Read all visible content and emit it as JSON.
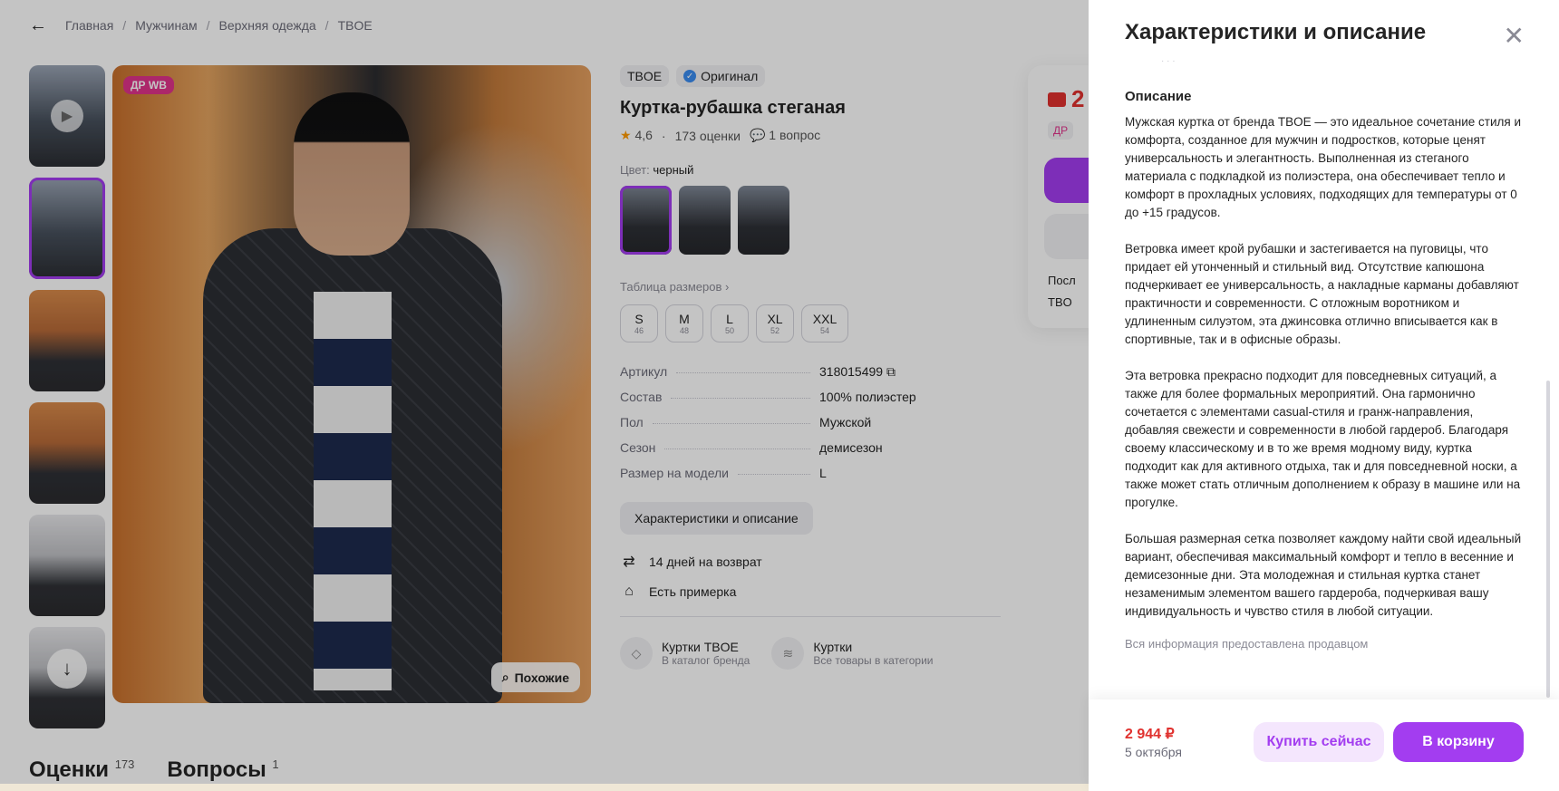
{
  "breadcrumb": {
    "back_label": "←",
    "items": [
      "Главная",
      "Мужчинам",
      "Верхняя одежда",
      "TBOE"
    ],
    "separator": "/"
  },
  "gallery": {
    "badge": "ДР WB",
    "similar_label": "Похожие"
  },
  "product": {
    "brand": "TBOE",
    "original_label": "Оригинал",
    "title": "Куртка-рубашка стеганая",
    "rating": "4,6",
    "reviews": "173 оценки",
    "questions": "1 вопрос",
    "color_label": "Цвет:",
    "color_value": "черный",
    "size_table_label": "Таблица размеров ›",
    "sizes": [
      {
        "size": "S",
        "num": "46"
      },
      {
        "size": "M",
        "num": "48"
      },
      {
        "size": "L",
        "num": "50"
      },
      {
        "size": "XL",
        "num": "52"
      },
      {
        "size": "XXL",
        "num": "54"
      }
    ],
    "params": [
      {
        "k": "Артикул",
        "v": "318015499"
      },
      {
        "k": "Состав",
        "v": "100% полиэстер"
      },
      {
        "k": "Пол",
        "v": "Мужской"
      },
      {
        "k": "Сезон",
        "v": "демисезон"
      },
      {
        "k": "Размер на модели",
        "v": "L"
      }
    ],
    "chars_button": "Характеристики и описание",
    "return_label": "14 дней на возврат",
    "fitting_label": "Есть примерка",
    "brand_cat_title": "Куртки TBOE",
    "brand_cat_sub": "В каталог бренда",
    "cat_title": "Куртки",
    "cat_sub": "Все товары в категории"
  },
  "buybox": {
    "price_partial": "2",
    "dr_partial": "ДР",
    "line1": "Посл",
    "line2": "TBO"
  },
  "bottom_tabs": {
    "reviews_label": "Оценки",
    "reviews_count": "173",
    "questions_label": "Вопросы",
    "questions_count": "1"
  },
  "panel": {
    "title": "Характеристики и описание",
    "close_icon": "✕",
    "section_title": "Описание",
    "paragraphs": [
      "Мужская куртка от бренда TBOE — это идеальное сочетание стиля и комфорта, созданное для мужчин и подростков, которые ценят универсальность и элегантность. Выполненная из стеганого материала с подкладкой из полиэстера, она обеспечивает тепло и комфорт в прохладных условиях, подходящих для температуры от 0 до +15 градусов.",
      "Ветровка имеет крой рубашки и застегивается на пуговицы, что придает ей утонченный и стильный вид. Отсутствие капюшона подчеркивает ее универсальность, а накладные карманы добавляют практичности и современности. С отложным воротником и удлиненным силуэтом, эта джинсовка отлично вписывается как в спортивные, так и в офисные образы.",
      "Эта ветровка прекрасно подходит для повседневных ситуаций, а также для более формальных мероприятий. Она гармонично сочетается с элементами casual-стиля и гранж-направления, добавляя свежести и современности в любой гардероб. Благодаря своему классическому и в то же время модному виду, куртка подходит как для активного отдыха, так и для повседневной носки, а также может стать отличным дополнением к образу в машине или на прогулке.",
      "Большая размерная сетка позволяет каждому найти свой идеальный вариант, обеспечивая максимальный комфорт и тепло в весенние и демисезонные дни. Эта молодежная и стильная куртка станет незаменимым элементом вашего гардероба, подчеркивая вашу индивидуальность и чувство стиля в любой ситуации."
    ],
    "seller_note": "Вся информация предоставлена продавцом",
    "price": "2 944 ₽",
    "date": "5 октября",
    "buy_now": "Купить сейчас",
    "to_cart": "В корзину"
  },
  "colors": {
    "accent": "#a33df0",
    "price": "#e0312e",
    "badge": "#e0338a"
  }
}
